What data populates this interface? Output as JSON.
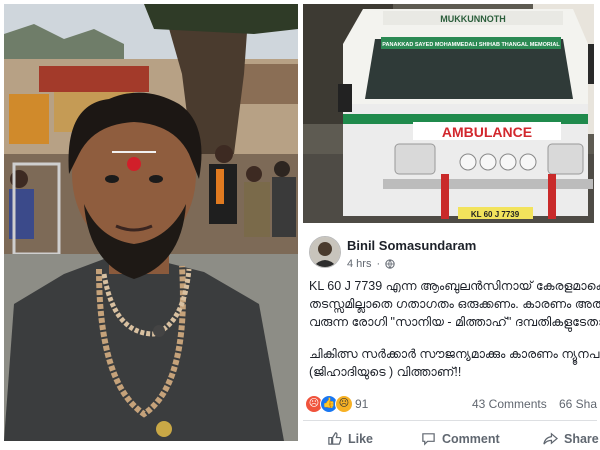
{
  "post": {
    "author_name": "Binil Somasundaram",
    "time": "4 hrs",
    "privacy_icon": "globe-icon",
    "text_lines": [
      "KL 60 J 7739 എന്ന ആംബുലൻസിനായ് കേരളമാകെ",
      "തടസ്സമില്ലാതെ ഗതാഗതം ഒരുക്കണം. കാരണം അതിൽ",
      "വരുന്ന രോഗി \"സാനിയ - മിത്താഹ്\" ദമ്പതികളുടേതാണ്",
      "ചികിത്സ സർക്കാർ സൗജന്യമാക്കും കാരണം ന്യൂനപക്ഷ",
      "(ജിഹാദിയുടെ ) വിത്താണ്!!"
    ],
    "reaction_count": "91",
    "comments": "43 Comments",
    "shares": "66 Sha",
    "actions": {
      "like": "Like",
      "comment": "Comment",
      "share": "Share"
    }
  },
  "ambulance": {
    "header_text": "MUKKUNNOTH",
    "windshield_text": "PANAKKAD SAYED MOHAMMEDALI SHIHAB THANGAL MEMORIAL",
    "body_text": "AMBULANCE",
    "plate": "KL 60 J 7739"
  },
  "colors": {
    "facebook_blue": "#385898",
    "ambulance_red": "#d2272d",
    "ambulance_green": "#1f8a4c"
  }
}
